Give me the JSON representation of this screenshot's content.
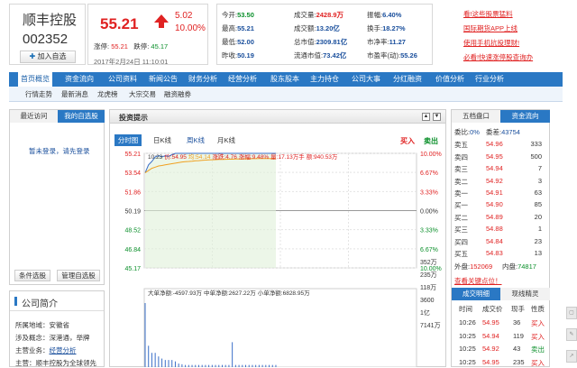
{
  "stock": {
    "name": "顺丰控股",
    "code": "002352",
    "add_label": "加入自选",
    "price": "55.21",
    "change": "5.02",
    "change_pct": "10.00%",
    "limit_up_label": "涨停:",
    "limit_up": "55.21",
    "limit_down_label": "跌停:",
    "limit_down": "45.17",
    "timestamp": "2017年2月24日 11:10:01"
  },
  "stats": [
    {
      "label": "今开:",
      "value": "53.50",
      "color": "#0a8f2a"
    },
    {
      "label": "成交量:",
      "value": "2428.9万",
      "color": "#e02222"
    },
    {
      "label": "振幅:",
      "value": "6.40%",
      "color": "#1a4f9c"
    },
    {
      "label": "最高:",
      "value": "55.21",
      "color": "#1a4f9c"
    },
    {
      "label": "成交额:",
      "value": "13.20亿",
      "color": "#1a4f9c"
    },
    {
      "label": "换手:",
      "value": "18.27%",
      "color": "#1a4f9c"
    },
    {
      "label": "最低:",
      "value": "52.00",
      "color": "#1a4f9c"
    },
    {
      "label": "总市值:",
      "value": "2309.81亿",
      "color": "#1a4f9c"
    },
    {
      "label": "市净率:",
      "value": "11.27",
      "color": "#1a4f9c"
    },
    {
      "label": "昨收:",
      "value": "50.19",
      "color": "#1a4f9c"
    },
    {
      "label": "流通市值:",
      "value": "73.42亿",
      "color": "#1a4f9c"
    },
    {
      "label": "市盈率(动):",
      "value": "55.26",
      "color": "#1a4f9c"
    }
  ],
  "ads": [
    "看!这些股票猛料",
    "国际期货APP上线",
    "使用手机抗投理财!",
    "必看!快速涨停股查询办"
  ],
  "nav": [
    "首页概览",
    "资金流向",
    "公司资料",
    "新闻公告",
    "财务分析",
    "经营分析",
    "股东股本",
    "主力持仓",
    "公司大事",
    "分红融资",
    "价值分析",
    "行业分析"
  ],
  "subnav": [
    "行情走势",
    "最新消息",
    "龙虎榜",
    "大宗交易",
    "融资融券"
  ],
  "left_panel": {
    "tab_recent": "最近访问",
    "tab_mine": "我的自选股",
    "login_msg": "暂未登录，请先登录",
    "btn_condition": "条件选股",
    "btn_manage": "管理自选股"
  },
  "intro": {
    "title": "公司简介",
    "rows": [
      {
        "label": "所属地域：",
        "value": "安徽省",
        "link": false
      },
      {
        "label": "涉及概念：",
        "value": "深港通，举牌",
        "link": false
      },
      {
        "label": "主营业务：",
        "value": "经营分析",
        "link": true
      },
      {
        "label": "主营：",
        "value": "顺丰控股为全球领先",
        "link": false
      }
    ]
  },
  "chart_panel": {
    "title": "投资提示",
    "tabs": [
      "分时图",
      "日K线",
      "周K线",
      "月K线"
    ],
    "buy": "买入",
    "sell": "卖出",
    "info_time": "10:23",
    "info_price": "价:54.95",
    "info_avg": "均:54.14",
    "info_chg": "涨跌:4.76",
    "info_pct": "涨幅:9.48%",
    "info_vol": "量:17.13万手",
    "info_amt": "额:940.53万",
    "flow_large": "大单净额:-4597.93万",
    "flow_mid": "中单净额:2627.22万",
    "flow_small": "小单净额:6828.95万"
  },
  "chart_data": {
    "type": "line",
    "price_ticks": [
      "55.21",
      "53.54",
      "51.86",
      "50.19",
      "48.52",
      "46.84",
      "45.17"
    ],
    "pct_ticks": [
      "10.00%",
      "6.67%",
      "3.33%",
      "0.00%",
      "3.33%",
      "6.67%",
      "10.00%"
    ],
    "vol_ticks": [
      "352万",
      "235万",
      "118万",
      "3600",
      "1亿",
      "7141万"
    ],
    "ylim": [
      45.17,
      55.21
    ],
    "prev_close": 50.19,
    "series": [
      {
        "values": [
          53.5,
          54.2,
          54.5,
          54.9,
          55.0,
          54.9,
          55.0,
          54.95,
          55.1,
          55.21,
          55.21,
          55.21,
          55.21,
          55.21,
          55.21,
          55.21,
          55.21,
          55.21,
          55.21,
          55.21,
          55.21,
          55.21,
          55.21,
          55.21,
          55.21,
          55.21,
          55.21,
          55.21,
          55.21,
          55.21,
          55.21,
          55.21,
          55.21,
          55.21,
          55.21,
          55.21,
          55.21,
          55.21,
          55.21,
          55.21
        ]
      },
      {
        "values": [
          53.5,
          53.7,
          53.9,
          54.0,
          54.1,
          54.14,
          54.2,
          54.25,
          54.3,
          54.35,
          54.4,
          54.45,
          54.48,
          54.5,
          54.52,
          54.55,
          54.57,
          54.6,
          54.62,
          54.64,
          54.65,
          54.66,
          54.67,
          54.68,
          54.69,
          54.7,
          54.7,
          54.71,
          54.72,
          54.72,
          54.73,
          54.73,
          54.74,
          54.74,
          54.75,
          54.75,
          54.75,
          54.76,
          54.76,
          54.76
        ]
      }
    ],
    "volumes": [
      9,
      3,
      2,
      2,
      1.5,
      1.2,
      1,
      1,
      1,
      0.8,
      0.5,
      0.4,
      0.3,
      0.3,
      0.3,
      0.3,
      0.3,
      0.3,
      0.3,
      0.3,
      0.3,
      0.3,
      0.3,
      0.3,
      0.3,
      0.3,
      3.5,
      0.3,
      0.3,
      0.3,
      0.3,
      0.3,
      0.3,
      0.3,
      0.3,
      0.3,
      0.3,
      0.3,
      0.3,
      0.3
    ]
  },
  "right_panel": {
    "tab_book": "五档盘口",
    "tab_flow": "资金流向",
    "weibi": "委比:",
    "weibi_v": "0%",
    "weicha": "委差:",
    "weicha_v": "43754",
    "sells": [
      {
        "label": "卖五",
        "price": "54.96",
        "vol": "333"
      },
      {
        "label": "卖四",
        "price": "54.95",
        "vol": "500"
      },
      {
        "label": "卖三",
        "price": "54.94",
        "vol": "7"
      },
      {
        "label": "卖二",
        "price": "54.92",
        "vol": "3"
      },
      {
        "label": "卖一",
        "price": "54.91",
        "vol": "63"
      }
    ],
    "buys": [
      {
        "label": "买一",
        "price": "54.90",
        "vol": "85"
      },
      {
        "label": "买二",
        "price": "54.89",
        "vol": "20"
      },
      {
        "label": "买三",
        "price": "54.88",
        "vol": "1"
      },
      {
        "label": "买四",
        "price": "54.84",
        "vol": "23"
      },
      {
        "label": "买五",
        "price": "54.83",
        "vol": "13"
      }
    ],
    "outer": "外盘:",
    "outer_v": "152069",
    "inner": "内盘:",
    "inner_v": "74817",
    "link": "查看关键点位！",
    "trade_tab1": "成交明细",
    "trade_tab2": "现线精灵",
    "trade_cols": [
      "时间",
      "成交价",
      "现手",
      "性质"
    ],
    "trades": [
      {
        "time": "10:26",
        "price": "54.95",
        "vol": "36",
        "type": "买入"
      },
      {
        "time": "10:25",
        "price": "54.94",
        "vol": "119",
        "type": "买入"
      },
      {
        "time": "10:25",
        "price": "54.92",
        "vol": "43",
        "type": "卖出"
      },
      {
        "time": "10:25",
        "price": "54.95",
        "vol": "235",
        "type": "买入"
      }
    ]
  }
}
